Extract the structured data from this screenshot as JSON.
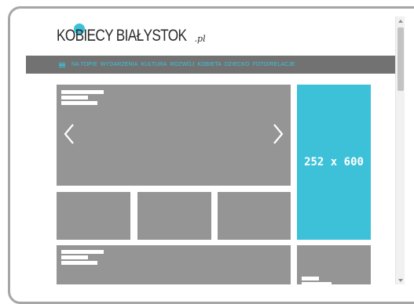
{
  "site": {
    "logo_main": "KOBIECY BIAŁYSTOK",
    "logo_suffix": ".pl"
  },
  "nav": {
    "items": [
      "NA TOPIE",
      "WYDARZENIA",
      "KULTURA",
      "ROZWÓJ",
      "KOBIETA",
      "DZIECKO",
      "FOTO/RELACJE"
    ]
  },
  "ad": {
    "label": "252 x 600"
  },
  "colors": {
    "accent": "#3cc1d9",
    "placeholder": "#959595",
    "nav_background": "#727272"
  }
}
